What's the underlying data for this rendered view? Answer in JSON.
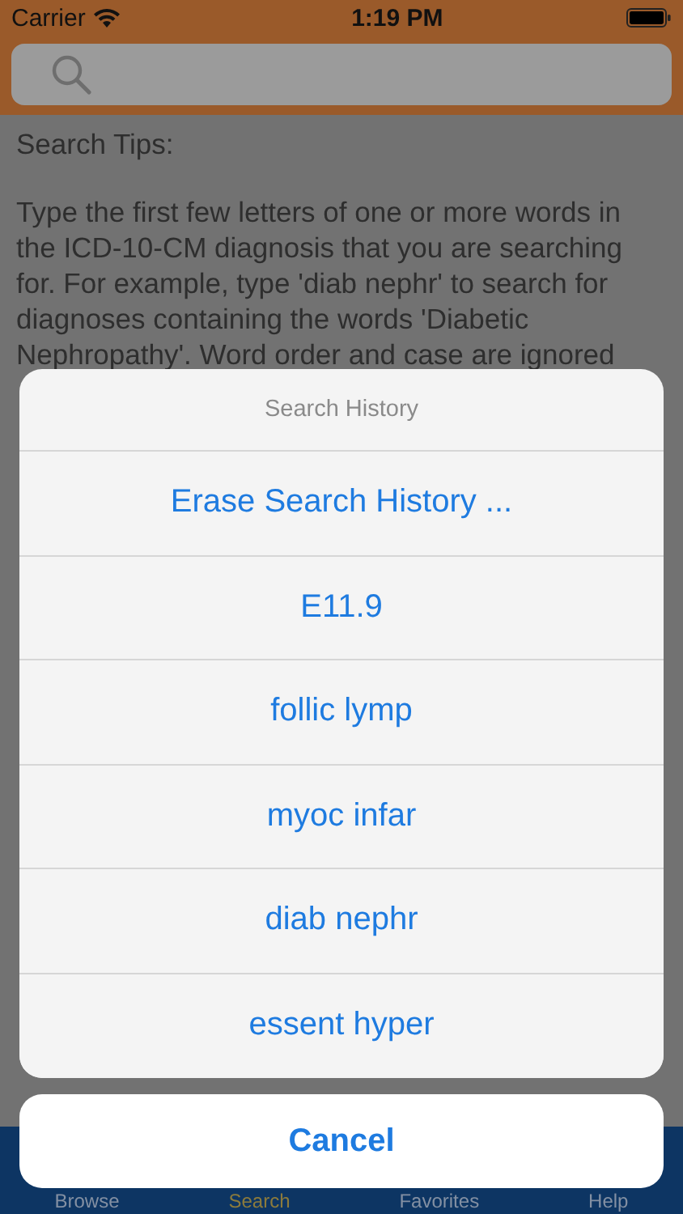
{
  "status_bar": {
    "carrier": "Carrier",
    "time": "1:19 PM"
  },
  "tips": {
    "title": "Search Tips:",
    "text": "Type the first few letters of one or more words in the ICD-10-CM diagnosis that you are searching for. For example, type 'diab nephr' to search for diagnoses containing the words 'Diabetic Nephropathy'. Word order and case are ignored"
  },
  "action_sheet": {
    "title": "Search History",
    "actions": [
      {
        "label": "Erase Search History ..."
      },
      {
        "label": "E11.9"
      },
      {
        "label": "follic lymp"
      },
      {
        "label": "myoc infar"
      },
      {
        "label": "diab nephr"
      },
      {
        "label": "essent hyper"
      }
    ],
    "cancel": "Cancel"
  },
  "tabs": [
    {
      "label": "Browse",
      "selected": false
    },
    {
      "label": "Search",
      "selected": true
    },
    {
      "label": "Favorites",
      "selected": false
    },
    {
      "label": "Help",
      "selected": false
    }
  ]
}
